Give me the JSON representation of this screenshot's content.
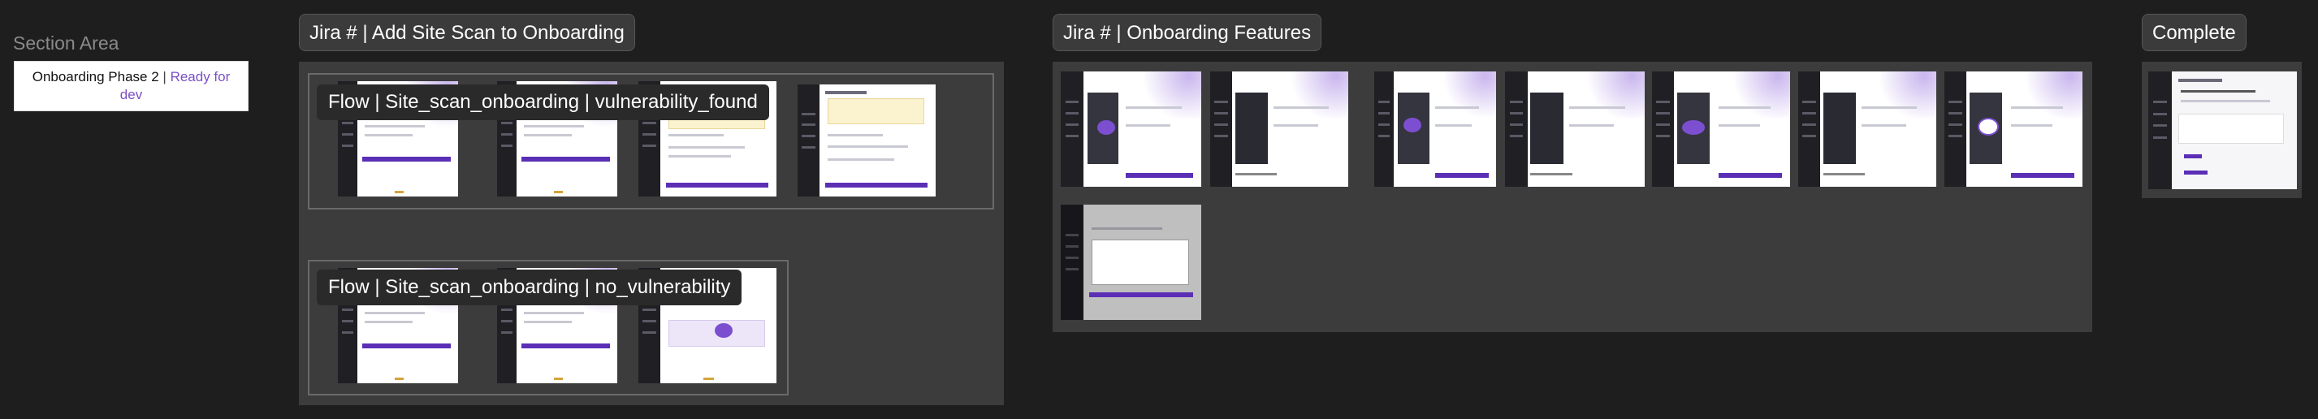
{
  "section_area": {
    "title": "Section Area",
    "note": {
      "text": "Onboarding Phase 2",
      "separator": "|",
      "status": "Ready for dev"
    }
  },
  "sections": [
    {
      "label": "Jira # | Add Site Scan to Onboarding",
      "flows": [
        {
          "label": "Flow | Site_scan_onboarding | vulnerability_found",
          "screens": 4
        },
        {
          "label": "Flow | Site_scan_onboarding | no_vulnerability",
          "screens": 3
        }
      ]
    },
    {
      "label": "Jira # | Onboarding Features",
      "screens": 8
    },
    {
      "label": "Complete",
      "screens": 1
    }
  ],
  "colors": {
    "canvas": "#1e1e1e",
    "section_bg": "#3c3c3c",
    "accent_purple": "#5a2fb5",
    "status_text": "#7a4fc4"
  }
}
